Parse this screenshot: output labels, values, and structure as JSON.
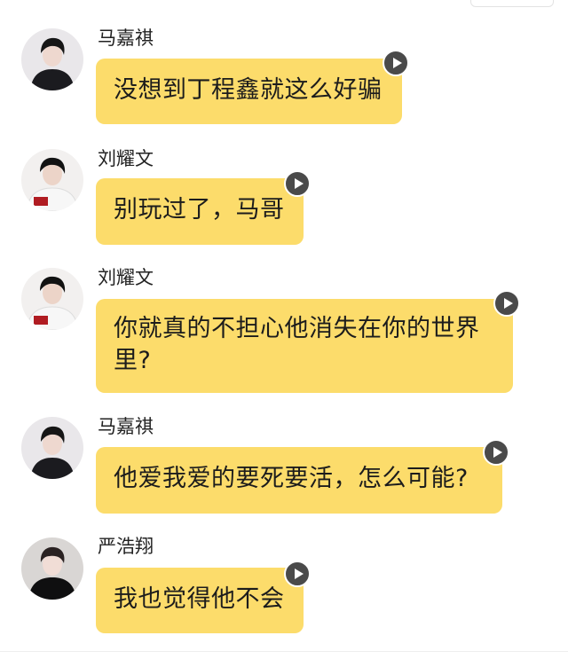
{
  "messages": [
    {
      "sender": "马嘉祺",
      "text": "没想到丁程鑫就这么好骗",
      "avatar_icon": "person-portrait-dark",
      "play_icon": "play-icon"
    },
    {
      "sender": "刘耀文",
      "text": "别玩过了，马哥",
      "avatar_icon": "person-portrait-white-shirt",
      "play_icon": "play-icon"
    },
    {
      "sender": "刘耀文",
      "text": "你就真的不担心他消失在你的世界里?",
      "avatar_icon": "person-portrait-white-shirt",
      "play_icon": "play-icon"
    },
    {
      "sender": "马嘉祺",
      "text": "他爱我爱的要死要活，怎么可能?",
      "avatar_icon": "person-portrait-dark",
      "play_icon": "play-icon"
    },
    {
      "sender": "严浩翔",
      "text": "我也觉得他不会",
      "avatar_icon": "person-portrait-black-jacket",
      "play_icon": "play-icon"
    }
  ],
  "colors": {
    "bubble": "#fcdc6b",
    "play_button": "#4a4a4a",
    "background": "#ffffff"
  }
}
